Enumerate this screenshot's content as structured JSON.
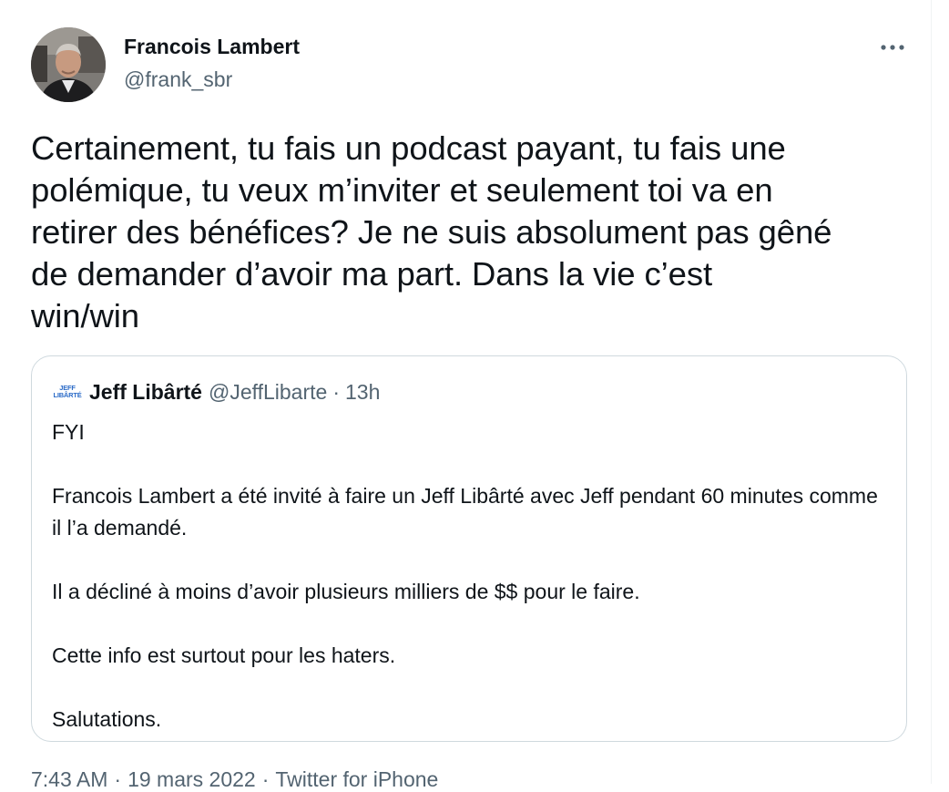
{
  "author": {
    "name": "Francois Lambert",
    "handle": "@frank_sbr"
  },
  "more_icon": "more-horizontal-icon",
  "tweet": {
    "text": "Certainement, tu fais un podcast payant, tu fais une\npolémique, tu veux m’inviter et seulement toi va en\nretirer des bénéfices? Je ne suis absolument pas gêné\nde demander d’avoir ma part. Dans la vie c’est\nwin/win"
  },
  "quoted": {
    "avatar_text": [
      "JEFF",
      "LIBÂRTÉ"
    ],
    "name": "Jeff Libârté",
    "handle": "@JeffLibarte",
    "separator": "·",
    "time": "13h",
    "paragraphs": [
      "FYI",
      "Francois Lambert a été invité à faire un Jeff Libârté avec Jeff pendant 60 minutes comme il l’a demandé.",
      "Il a décliné à moins d’avoir plusieurs milliers de $$ pour le faire.",
      "Cette info est surtout pour les haters.",
      "Salutations."
    ]
  },
  "meta": {
    "time": "7:43 AM",
    "separator": "·",
    "date": "19 mars 2022",
    "source": "Twitter for iPhone"
  },
  "colors": {
    "text": "#0f1419",
    "secondary": "#536471",
    "border": "#cfd9de",
    "quote_avatar": "#2a6ac7"
  }
}
